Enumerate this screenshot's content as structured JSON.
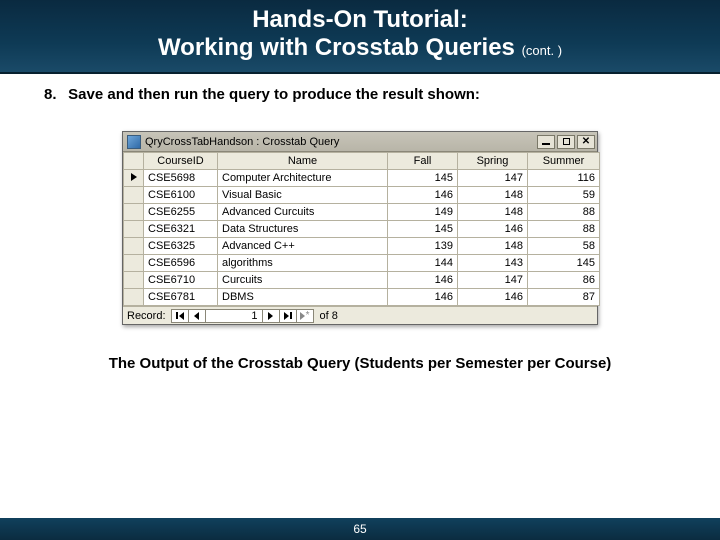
{
  "slide": {
    "title_line1": "Hands-On Tutorial:",
    "title_line2": "Working with Crosstab Queries",
    "title_cont": "(cont. )",
    "step_number": "8.",
    "step_text": "Save and then run the query to produce the result shown:",
    "caption": "The Output of the Crosstab Query (Students per Semester per Course)",
    "page_number": "65"
  },
  "window": {
    "title": "QryCrossTabHandson : Crosstab Query",
    "columns": [
      "CourseID",
      "Name",
      "Fall",
      "Spring",
      "Summer"
    ],
    "rows": [
      {
        "id": "CSE5698",
        "name": "Computer Architecture",
        "fall": 145,
        "spring": 147,
        "summer": 116
      },
      {
        "id": "CSE6100",
        "name": "Visual Basic",
        "fall": 146,
        "spring": 148,
        "summer": 59
      },
      {
        "id": "CSE6255",
        "name": "Advanced Curcuits",
        "fall": 149,
        "spring": 148,
        "summer": 88
      },
      {
        "id": "CSE6321",
        "name": "Data Structures",
        "fall": 145,
        "spring": 146,
        "summer": 88
      },
      {
        "id": "CSE6325",
        "name": "Advanced C++",
        "fall": 139,
        "spring": 148,
        "summer": 58
      },
      {
        "id": "CSE6596",
        "name": "algorithms",
        "fall": 144,
        "spring": 143,
        "summer": 145
      },
      {
        "id": "CSE6710",
        "name": "Curcuits",
        "fall": 146,
        "spring": 147,
        "summer": 86
      },
      {
        "id": "CSE6781",
        "name": "DBMS",
        "fall": 146,
        "spring": 146,
        "summer": 87
      }
    ],
    "record_nav": {
      "label": "Record:",
      "current": "1",
      "of_label": "of",
      "total": "8"
    }
  }
}
